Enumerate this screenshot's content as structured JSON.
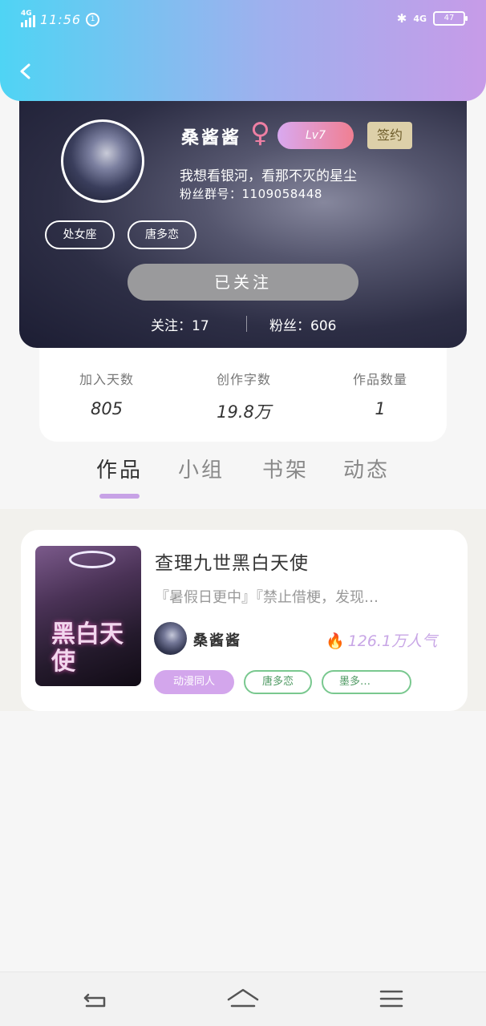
{
  "status_bar": {
    "network_left": "4G",
    "time": "11:56",
    "mini_badge": "1",
    "network_right": "4G",
    "battery": "47"
  },
  "profile": {
    "name": "桑酱酱",
    "gender_symbol": "♀",
    "level": "Lv7",
    "signed_badge": "签约",
    "motto": "我想看银河，看那不灭的星尘",
    "fans_group": "粉丝群号：1109058448",
    "tags": [
      "处女座",
      "唐多恋"
    ],
    "follow_button": "已关注",
    "following_label": "关注：17",
    "fans_label": "粉丝：606"
  },
  "stats": [
    {
      "label": "加入天数",
      "value": "805"
    },
    {
      "label": "创作字数",
      "value": "19.8万"
    },
    {
      "label": "作品数量",
      "value": "1"
    }
  ],
  "tabs": [
    "作品",
    "小组",
    "书架",
    "动态"
  ],
  "work": {
    "title": "查理九世黑白天使",
    "description": "『暑假日更中』『禁止借梗，发现…",
    "cover_text": "黑白天使",
    "author": "桑酱酱",
    "popularity": "126.1万人气",
    "tags": [
      "动漫同人",
      "唐多恋",
      "墨多…"
    ]
  },
  "colors": {
    "accent_purple": "#c7a2e6",
    "tag_green": "#79c88f",
    "level_pink": "#f07f92"
  },
  "icons": [
    "back-arrow-icon",
    "bluetooth-icon",
    "battery-icon",
    "female-icon",
    "flame-icon",
    "nav-back-icon",
    "nav-home-icon",
    "nav-menu-icon"
  ]
}
